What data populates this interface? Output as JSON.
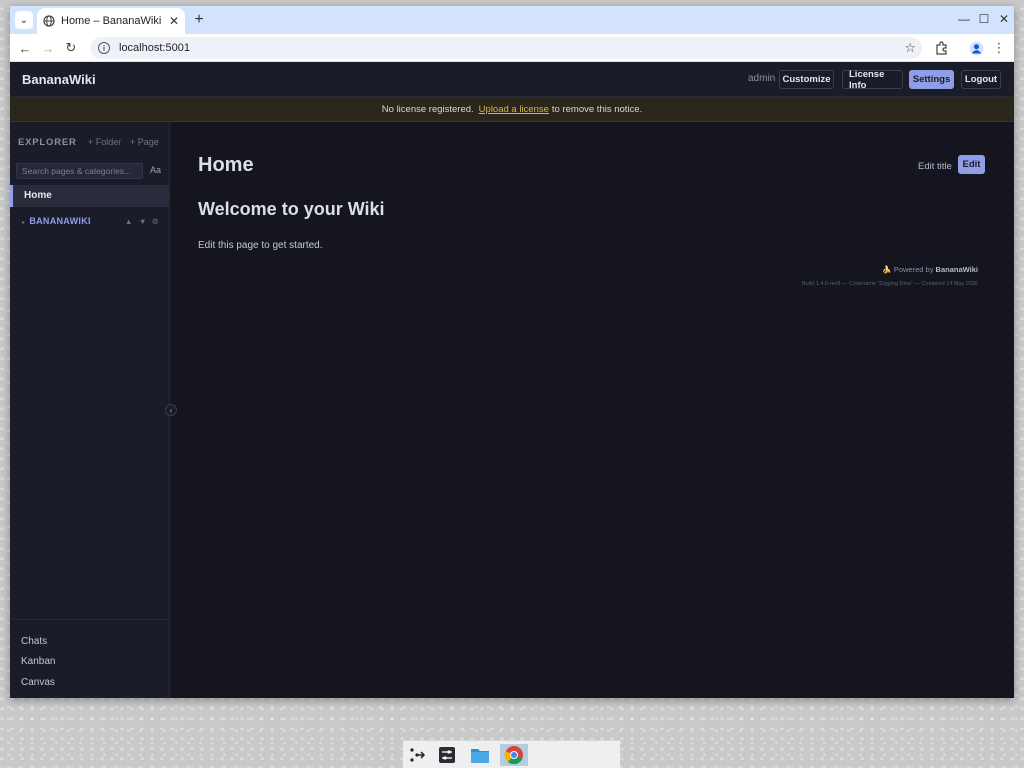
{
  "browser": {
    "tab_title": "Home – BananaWiki",
    "address": "localhost:5001"
  },
  "app": {
    "brand": "BananaWiki",
    "user": "admin",
    "nav_buttons": [
      "Customize",
      "License Info",
      "Settings",
      "Logout"
    ],
    "notice": {
      "text_before": "No license registered.",
      "link": "Upload a license",
      "text_after": "to remove this notice."
    }
  },
  "sidebar": {
    "explorer_label": "EXPLORER",
    "add_folder": "+ Folder",
    "add_page": "+ Page",
    "search_placeholder": "Search pages & categories...",
    "case_toggle": "Aa",
    "active_page": "Home",
    "folder": "BANANAWIKI",
    "bottom_links": [
      "Chats",
      "Kanban",
      "Canvas"
    ]
  },
  "page": {
    "title": "Home",
    "edit_title": "Edit title",
    "edit": "Edit",
    "heading": "Welcome to your Wiki",
    "body": "Edit this page to get started.",
    "powered_prefix": "Powered by",
    "powered_brand": "BananaWiki",
    "build": "Build 1.4.0-rev8 — Codename \"Digging Dino\" — Compiled 14 May 2026"
  },
  "icons": {
    "tab_favicon": "globe-icon",
    "accent": "#8f9ee6",
    "notice_link_color": "#d8b352"
  }
}
